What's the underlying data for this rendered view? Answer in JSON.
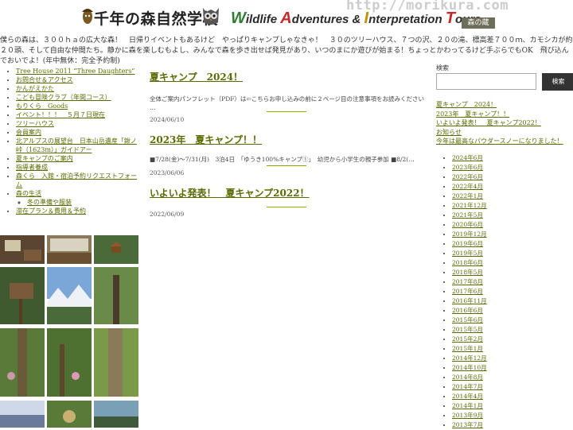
{
  "header": {
    "site_title": "千年の森自然学校",
    "tagline": {
      "w": "W",
      "ildlife": "ildlife ",
      "a": "A",
      "dventures": "dventures & ",
      "i": "I",
      "nterpretation": "nterpretation ",
      "t": "T",
      "ours": "ours"
    },
    "url_watermark": "http://morikura.com",
    "badge_text": "森の蔵"
  },
  "intro": "僕らの森は、３００ｈａの広大な森！　日帰りイベントもあるけど　やっぱりキャンプしゃなきゃ！　３０のツリーハウス、７つの沢、２０の滝、標高差７００ｍ、カモシカが約２０頭、そして自由な仲間たち。静かに森を楽しむもよし、みんなで森を歩き出せば発見があり、いつのまにか遊びが始まる！ちょっとかわってるけど手ぶらでもOK　飛び込んでおいでよ！(年中無休：完全予約制)",
  "nav": {
    "items": [
      "Tree House 2011 “Three Daughters”",
      "お問合せ＆アクセス",
      "かんがえかた",
      "こども冒険クラブ（年間コース）",
      "もりくら　Goods",
      "イベント！！！　５月７日現在",
      "ツリーハウス",
      "会員案内",
      "北アルプスの展望台　日本山岳遺産「鍬ノ峠（1623m）」ガイドアー",
      "夏キャンプのご案内",
      "指導者養成",
      "森くら　入館・宿泊予約リクエストフォーム",
      "森の生活"
    ],
    "sub_item": "冬の準備や服装",
    "last_item": "滞在プラン＆費用＆予約"
  },
  "posts": [
    {
      "title": "夏キャンプ　2024！",
      "excerpt": "全体ご案内パンフレット（PDF）は⇦こちらお申し込みの前に２ページ目の注意事項をお読みください …",
      "date": "2024/06/10"
    },
    {
      "title": "2023年　夏キャンプ！！",
      "excerpt": "■7/28(金)〜7/31(月)　3泊4日　「ゆうき100%キャンプ①」　幼児から小学生の親子参加 ■8/2(…",
      "date": "2023/06/06"
    },
    {
      "title": "いよいよ発表！　夏キャンプ2022！",
      "excerpt": "",
      "date": "2022/06/09"
    }
  ],
  "sidebar": {
    "search_label": "検索",
    "search_placeholder": "",
    "search_button": "検索",
    "recent": [
      "夏キャンプ　2024！",
      "2023年　夏キャンプ！！",
      "いよいよ発表！　夏キャンプ2022！",
      "お知らせ",
      "今年は最高なパウダースノーになりました！"
    ],
    "archives": [
      "2024年6月",
      "2023年6月",
      "2022年6月",
      "2022年4月",
      "2022年1月",
      "2021年12月",
      "2021年5月",
      "2020年6月",
      "2019年12月",
      "2019年6月",
      "2019年5月",
      "2018年6月",
      "2018年5月",
      "2017年8月",
      "2017年6月",
      "2016年11月",
      "2016年6月",
      "2015年6月",
      "2015年5月",
      "2015年2月",
      "2015年1月",
      "2014年12月",
      "2014年10月",
      "2014年8月",
      "2014年7月",
      "2014年4月",
      "2014年1月",
      "2013年9月",
      "2013年7月"
    ]
  },
  "colors": {
    "link": "#5a6b00",
    "separator": "#8aa800",
    "search_button": "#333333"
  },
  "icons": {
    "logo": "acorn-character-icon",
    "mascot": "owl-face-icon"
  }
}
